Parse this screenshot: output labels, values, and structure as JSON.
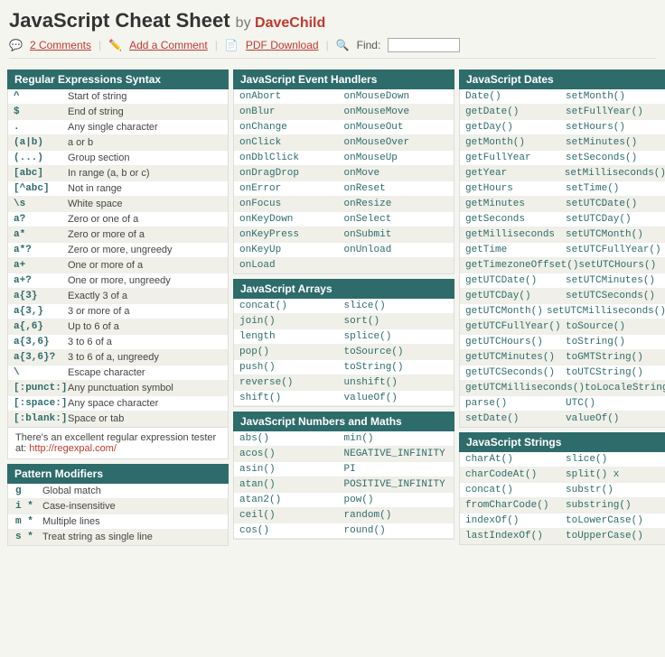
{
  "header": {
    "title": "JavaScript Cheat Sheet",
    "by": "by",
    "author": "DaveChild",
    "toolbar": {
      "comments": "2 Comments",
      "add_comment": "Add a Comment",
      "pdf": "PDF Download",
      "find": "Find:"
    }
  },
  "regex": {
    "title": "Regular Expressions Syntax",
    "rows": [
      {
        "sym": "^",
        "desc": "Start of string"
      },
      {
        "sym": "$",
        "desc": "End of string"
      },
      {
        "sym": ".",
        "desc": "Any single character"
      },
      {
        "sym": "(a|b)",
        "desc": "a or b"
      },
      {
        "sym": "(...)",
        "desc": "Group section"
      },
      {
        "sym": "[abc]",
        "desc": "In range (a, b or c)"
      },
      {
        "sym": "[^abc]",
        "desc": "Not in range"
      },
      {
        "sym": "\\s",
        "desc": "White space"
      },
      {
        "sym": "a?",
        "desc": "Zero or one of a"
      },
      {
        "sym": "a*",
        "desc": "Zero or more of a"
      },
      {
        "sym": "a*?",
        "desc": "Zero or more, ungreedy"
      },
      {
        "sym": "a+",
        "desc": "One or more of a"
      },
      {
        "sym": "a+?",
        "desc": "One or more, ungreedy"
      },
      {
        "sym": "a{3}",
        "desc": "Exactly 3 of a"
      },
      {
        "sym": "a{3,}",
        "desc": "3 or more of a"
      },
      {
        "sym": "a{,6}",
        "desc": "Up to 6 of a"
      },
      {
        "sym": "a{3,6}",
        "desc": "3 to 6 of a"
      },
      {
        "sym": "a{3,6}?",
        "desc": "3 to 6 of a, ungreedy"
      },
      {
        "sym": "\\",
        "desc": "Escape character"
      },
      {
        "sym": "[:punct:]",
        "desc": "Any punctuation symbol"
      },
      {
        "sym": "[:space:]",
        "desc": "Any space character"
      },
      {
        "sym": "[:blank:]",
        "desc": "Space or tab"
      }
    ],
    "note": "There's an excellent regular expression tester at:",
    "note_link": "http://regexpal.com/",
    "note_link_display": "http://regexpal.com/"
  },
  "pattern_modifiers": {
    "title": "Pattern Modifiers",
    "rows": [
      {
        "sym": "g",
        "desc": "Global match"
      },
      {
        "sym": "i *",
        "desc": "Case-insensitive"
      },
      {
        "sym": "m *",
        "desc": "Multiple lines"
      },
      {
        "sym": "s *",
        "desc": "Treat string as single line"
      }
    ]
  },
  "events": {
    "title": "JavaScript Event Handlers",
    "col1": [
      "onAbort",
      "onBlur",
      "onChange",
      "onClick",
      "onDblClick",
      "onDragDrop",
      "onError",
      "onFocus",
      "onKeyDown",
      "onKeyPress",
      "onKeyUp",
      "onLoad"
    ],
    "col2": [
      "onMouseDown",
      "onMouseMove",
      "onMouseOut",
      "onMouseOver",
      "onMouseUp",
      "onMove",
      "onReset",
      "onResize",
      "onSelect",
      "onSubmit",
      "onUnload",
      ""
    ]
  },
  "arrays": {
    "title": "JavaScript Arrays",
    "col1": [
      "concat()",
      "join()",
      "length",
      "pop()",
      "push()",
      "reverse()",
      "shift()"
    ],
    "col2": [
      "slice()",
      "sort()",
      "splice()",
      "toSource()",
      "toString()",
      "unshift()",
      "valueOf()"
    ]
  },
  "numbers": {
    "title": "JavaScript Numbers and Maths",
    "col1": [
      "abs()",
      "acos()",
      "asin()",
      "atan()",
      "atan2()",
      "ceil()",
      "cos()"
    ],
    "col2": [
      "min()",
      "NEGATIVE_INFINITY",
      "PI",
      "POSITIVE_INFINITY",
      "pow()",
      "random()",
      "round()"
    ]
  },
  "dates": {
    "title": "JavaScript Dates",
    "col1": [
      "Date()",
      "getDate()",
      "getDay()",
      "getMonth()",
      "getFullYear",
      "getYear",
      "getHours",
      "getMinutes",
      "getSeconds",
      "getMilliseconds",
      "getTime",
      "getTimezoneOffset()",
      "getUTCDate()",
      "getUTCDay()",
      "getUTCMonth()",
      "getUTCFullYear()",
      "getUTCHours()",
      "getUTCMinutes()",
      "getUTCSeconds()",
      "getUTCMilliseconds()",
      "parse()",
      "setDate()"
    ],
    "col2": [
      "setMonth()",
      "setFullYear()",
      "setHours()",
      "setMinutes()",
      "setSeconds()",
      "setMilliseconds()",
      "setTime()",
      "setUTCDate()",
      "setUTCDay()",
      "setUTCMonth()",
      "setUTCFullYear()",
      "setUTCHours()",
      "setUTCMinutes()",
      "setUTCSeconds()",
      "setUTCMilliseconds()",
      "toSource()",
      "toString()",
      "toGMTString()",
      "toUTCString()",
      "toLocaleString()",
      "UTC()",
      "valueOf()"
    ]
  },
  "strings": {
    "title": "JavaScript Strings",
    "col1": [
      "charAt()",
      "charCodeAt()",
      "concat()",
      "fromCharCode()",
      "indexOf()",
      "lastIndexOf()"
    ],
    "col2": [
      "slice()",
      "split() x",
      "substr()",
      "substring()",
      "toLowerCase()",
      "toUpperCase()"
    ]
  }
}
